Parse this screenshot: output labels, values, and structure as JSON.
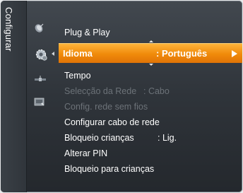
{
  "sidebar": {
    "label": "Configurar"
  },
  "icons": [
    "dish-icon",
    "gear-icon",
    "satellite-icon",
    "input-icon"
  ],
  "menu": {
    "items": [
      {
        "label": "Plug & Play",
        "value": "",
        "state": "normal"
      },
      {
        "label": "Idioma",
        "value": ": Português",
        "state": "selected"
      },
      {
        "label": "Tempo",
        "value": "",
        "state": "normal"
      },
      {
        "label": "Selecção da Rede",
        "value": ": Cabo",
        "state": "disabled"
      },
      {
        "label": "Config. rede sem fios",
        "value": "",
        "state": "disabled"
      },
      {
        "label": "Configurar cabo de rede",
        "value": "",
        "state": "normal"
      },
      {
        "label": "Bloqueio crianças",
        "value": ": Lig.",
        "state": "normal"
      },
      {
        "label": "Alterar PIN",
        "value": "",
        "state": "normal"
      },
      {
        "label": "Bloqueio para crianças",
        "value": "",
        "state": "normal"
      }
    ]
  },
  "colors": {
    "accent": "#f39218",
    "disabled_text": "#6c7278",
    "background": "#30353b"
  }
}
